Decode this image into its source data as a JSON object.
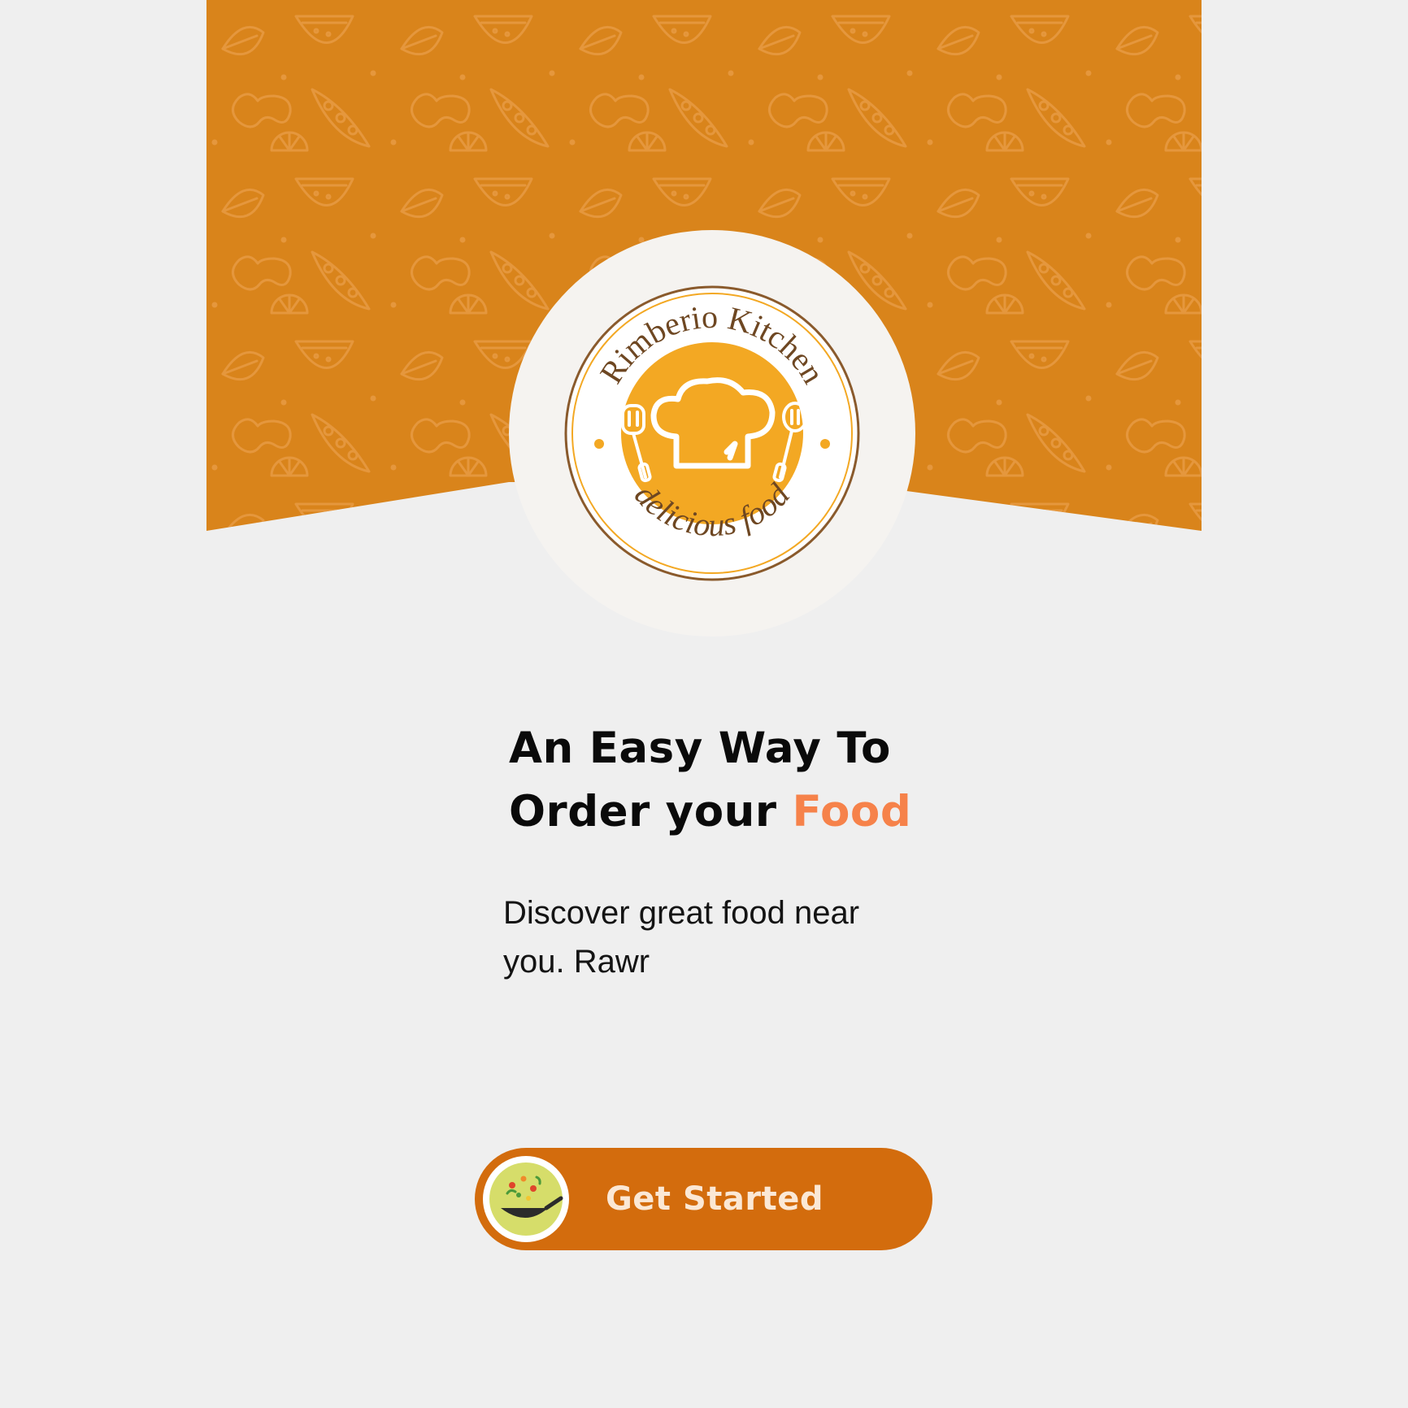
{
  "brand": {
    "name": "Rimberio Kitchen",
    "tagline": "delicious food"
  },
  "headline": {
    "line1": "An Easy Way To",
    "line2_prefix": "Order your ",
    "line2_accent": "Food"
  },
  "subtitle": {
    "line1": "Discover great food near",
    "line2": "you. Rawr"
  },
  "cta": {
    "label": "Get Started"
  },
  "colors": {
    "hero_orange": "#d9841b",
    "accent_orange": "#f6824a",
    "button_orange": "#d36c0d",
    "logo_gold": "#f3a823",
    "logo_brown": "#7a4f25",
    "background": "#efefef"
  },
  "icons": {
    "logo": "chef-hat-with-utensils-icon",
    "cta_badge": "wok-with-vegetables-icon"
  }
}
